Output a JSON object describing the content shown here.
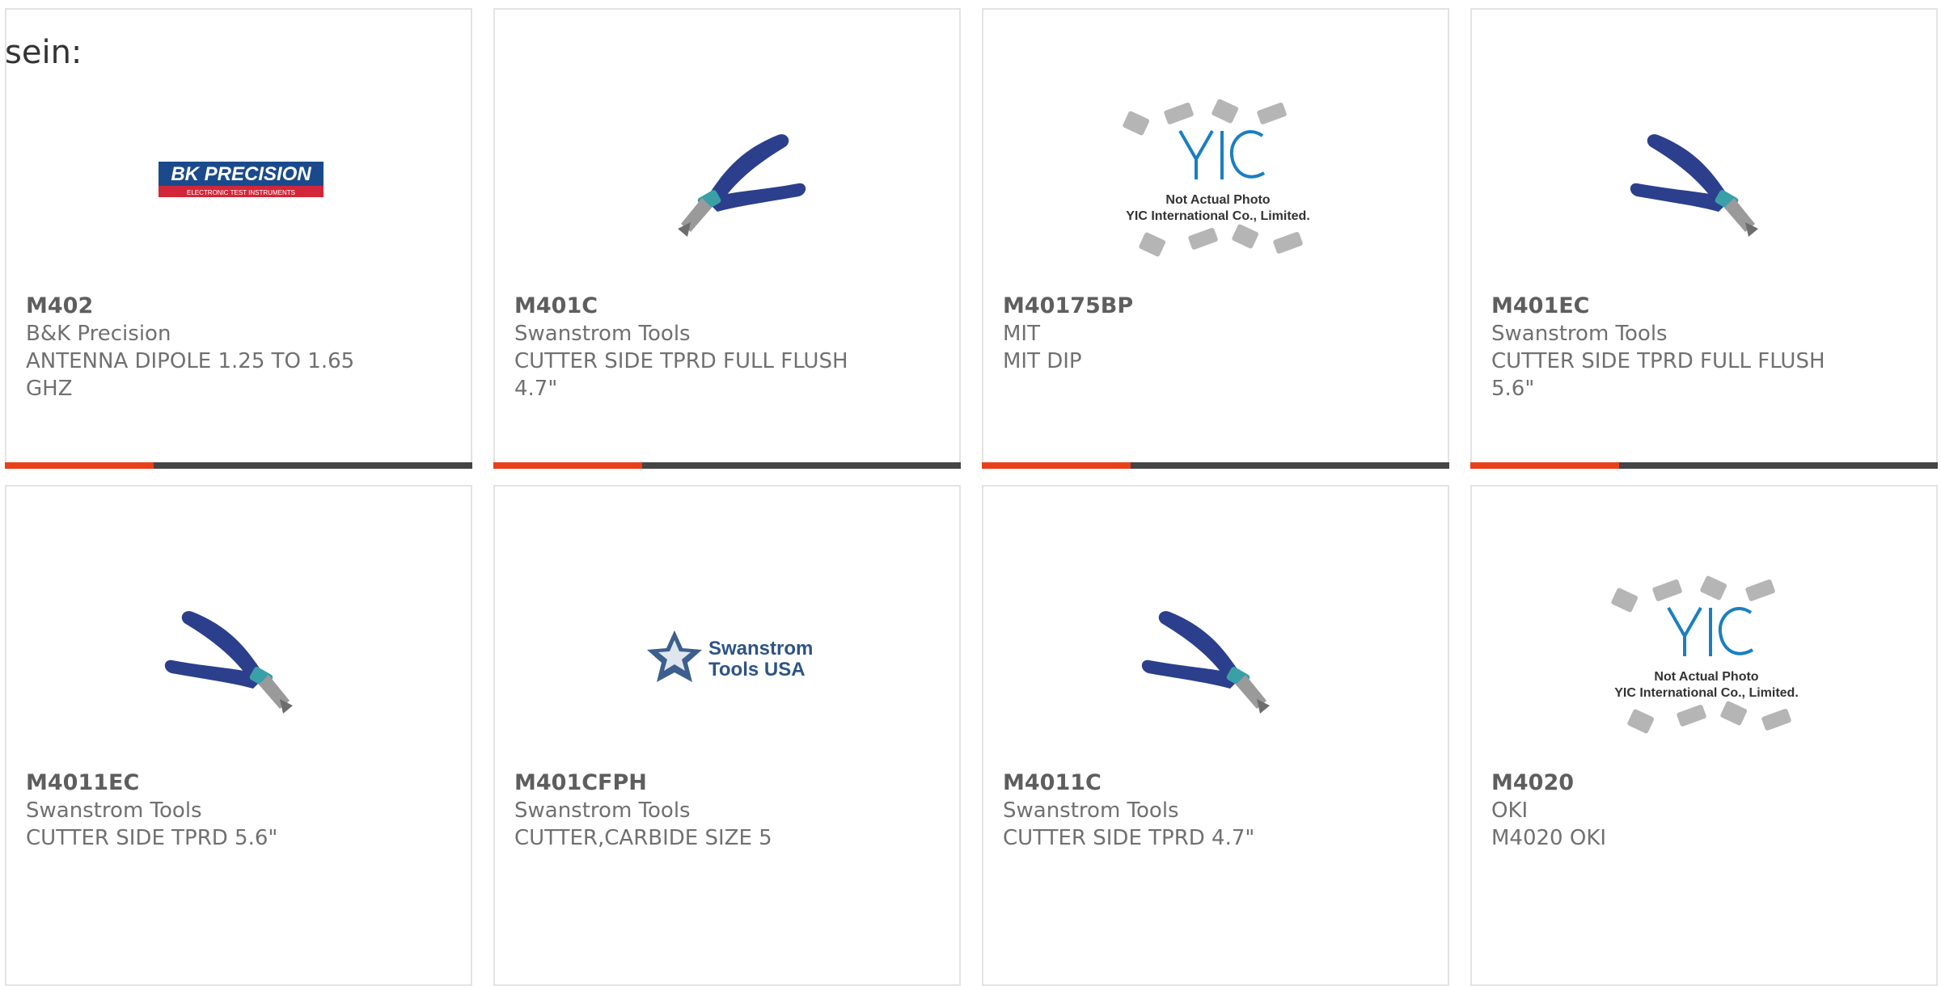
{
  "intro_text": "sein:",
  "colors": {
    "accent": "#e8401a",
    "bar": "#454545",
    "border": "#e3e3e3",
    "pliers_handle": "#2b3f8c"
  },
  "products": [
    {
      "part": "M402",
      "manufacturer": "B&K Precision",
      "description": "ANTENNA DIPOLE 1.25 TO 1.65 GHZ",
      "image": "bk-precision-logo",
      "logo_text": "BK PRECISION",
      "logo_sub": "ELECTRONIC TEST INSTRUMENTS"
    },
    {
      "part": "M401C",
      "manufacturer": "Swanstrom Tools",
      "description": "CUTTER SIDE TPRD FULL FLUSH 4.7\"",
      "image": "pliers-photo-1"
    },
    {
      "part": "M40175BP",
      "manufacturer": "MIT",
      "description": "MIT DIP",
      "image": "yic-placeholder",
      "yic_line1": "Not Actual Photo",
      "yic_line2": "YIC International Co., Limited."
    },
    {
      "part": "M401EC",
      "manufacturer": "Swanstrom Tools",
      "description": "CUTTER SIDE TPRD FULL FLUSH 5.6\"",
      "image": "pliers-photo-2"
    },
    {
      "part": "M4011EC",
      "manufacturer": "Swanstrom Tools",
      "description": "CUTTER SIDE TPRD 5.6\"",
      "image": "pliers-photo-3"
    },
    {
      "part": "M401CFPH",
      "manufacturer": "Swanstrom Tools",
      "description": "CUTTER,CARBIDE SIZE 5",
      "image": "swanstrom-logo",
      "logo_text_1": "Swanstrom",
      "logo_text_2": "Tools USA"
    },
    {
      "part": "M4011C",
      "manufacturer": "Swanstrom Tools",
      "description": "CUTTER SIDE TPRD 4.7\"",
      "image": "pliers-photo-4"
    },
    {
      "part": "M4020",
      "manufacturer": "OKI",
      "description": "M4020 OKI",
      "image": "yic-placeholder",
      "yic_line1": "Not Actual Photo",
      "yic_line2": "YIC International Co., Limited."
    }
  ]
}
